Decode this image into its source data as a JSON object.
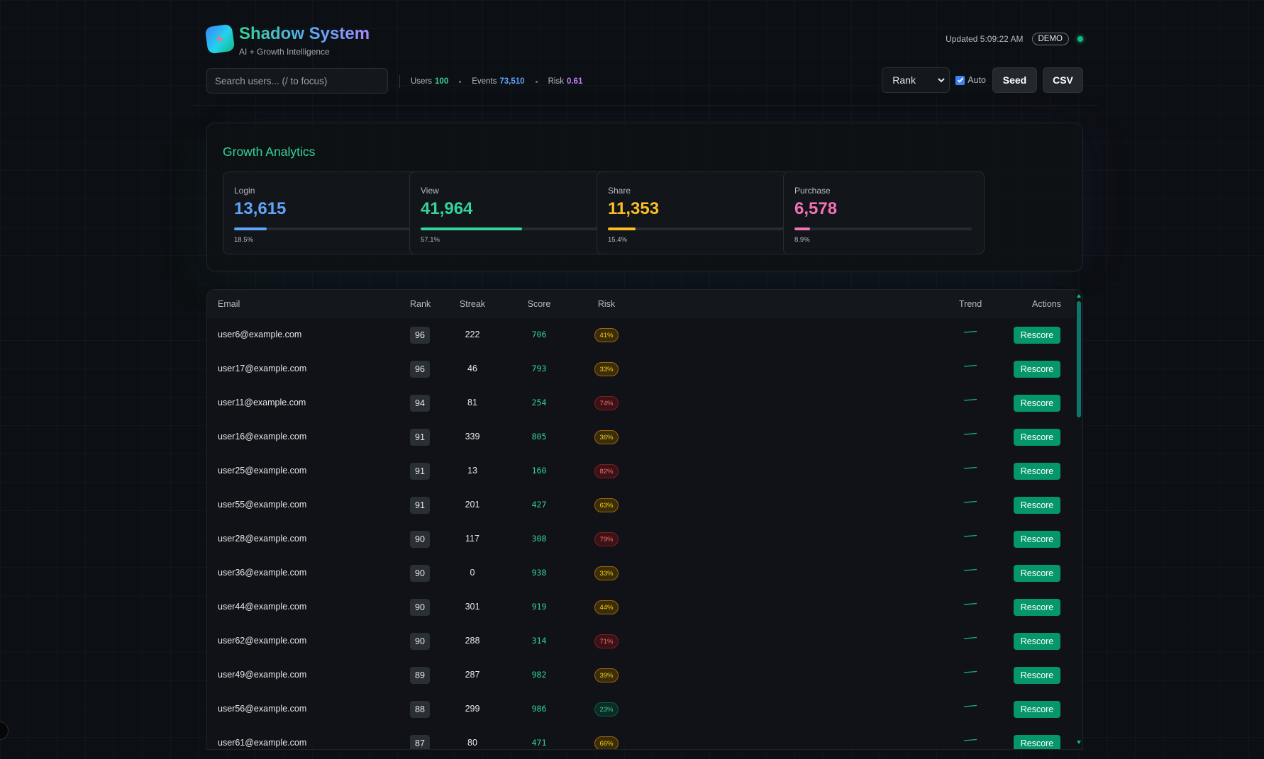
{
  "brand": {
    "title": "Shadow System",
    "subtitle": "AI + Growth Intelligence"
  },
  "header": {
    "updated": "Updated 5:09:22 AM",
    "badge": "DEMO",
    "status_color": "#10b981"
  },
  "search": {
    "placeholder": "Search users... (/ to focus)",
    "value": ""
  },
  "stats": {
    "users_label": "Users",
    "users_value": "100",
    "events_label": "Events",
    "events_value": "73,510",
    "risk_label": "Risk",
    "risk_value": "0.61"
  },
  "controls": {
    "sort_selected": "Rank",
    "auto_label": "Auto",
    "auto_checked": true,
    "seed_label": "Seed",
    "csv_label": "CSV"
  },
  "analytics": {
    "title": "Growth Analytics",
    "metrics": [
      {
        "label": "Login",
        "value": "13,615",
        "pct": "18.5%",
        "fill": 0.185,
        "color": "#60a5fa"
      },
      {
        "label": "View",
        "value": "41,964",
        "pct": "57.1%",
        "fill": 0.571,
        "color": "#34d399"
      },
      {
        "label": "Share",
        "value": "11,353",
        "pct": "15.4%",
        "fill": 0.154,
        "color": "#fbbf24"
      },
      {
        "label": "Purchase",
        "value": "6,578",
        "pct": "8.9%",
        "fill": 0.089,
        "color": "#f472b6"
      }
    ]
  },
  "table": {
    "headers": {
      "email": "Email",
      "rank": "Rank",
      "streak": "Streak",
      "score": "Score",
      "risk": "Risk",
      "trend": "Trend",
      "actions": "Actions"
    },
    "action_label": "Rescore",
    "rows": [
      {
        "email": "user6@example.com",
        "rank": "96",
        "streak": "222",
        "score": "706",
        "risk": "41%",
        "level": "med"
      },
      {
        "email": "user17@example.com",
        "rank": "96",
        "streak": "46",
        "score": "793",
        "risk": "33%",
        "level": "med"
      },
      {
        "email": "user11@example.com",
        "rank": "94",
        "streak": "81",
        "score": "254",
        "risk": "74%",
        "level": "high"
      },
      {
        "email": "user16@example.com",
        "rank": "91",
        "streak": "339",
        "score": "805",
        "risk": "36%",
        "level": "med"
      },
      {
        "email": "user25@example.com",
        "rank": "91",
        "streak": "13",
        "score": "160",
        "risk": "82%",
        "level": "high"
      },
      {
        "email": "user55@example.com",
        "rank": "91",
        "streak": "201",
        "score": "427",
        "risk": "63%",
        "level": "med"
      },
      {
        "email": "user28@example.com",
        "rank": "90",
        "streak": "117",
        "score": "308",
        "risk": "79%",
        "level": "high"
      },
      {
        "email": "user36@example.com",
        "rank": "90",
        "streak": "0",
        "score": "938",
        "risk": "33%",
        "level": "med"
      },
      {
        "email": "user44@example.com",
        "rank": "90",
        "streak": "301",
        "score": "919",
        "risk": "44%",
        "level": "med"
      },
      {
        "email": "user62@example.com",
        "rank": "90",
        "streak": "288",
        "score": "314",
        "risk": "71%",
        "level": "high"
      },
      {
        "email": "user49@example.com",
        "rank": "89",
        "streak": "287",
        "score": "982",
        "risk": "39%",
        "level": "med"
      },
      {
        "email": "user56@example.com",
        "rank": "88",
        "streak": "299",
        "score": "986",
        "risk": "23%",
        "level": "low"
      },
      {
        "email": "user61@example.com",
        "rank": "87",
        "streak": "80",
        "score": "471",
        "risk": "66%",
        "level": "med"
      }
    ]
  }
}
